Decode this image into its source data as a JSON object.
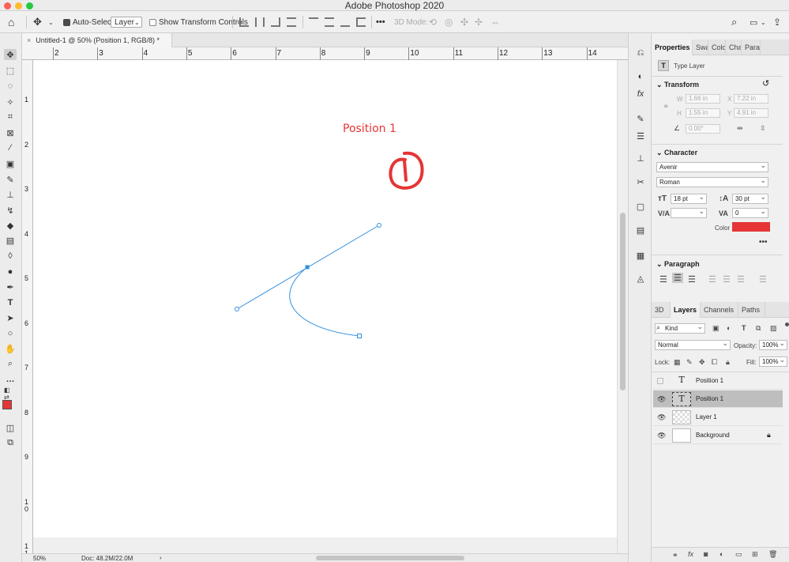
{
  "window": {
    "title": "Adobe Photoshop 2020"
  },
  "options_bar": {
    "auto_select_label": "Auto-Select:",
    "auto_select_value": "Layer",
    "transform_controls_label": "Show Transform Controls",
    "mode_3d_label": "3D Mode:",
    "more_label": "•••"
  },
  "document": {
    "tab_title": "Untitled-1 @ 50% (Position 1, RGB/8) *",
    "close_glyph": "×",
    "zoom": "50%",
    "doc_info": "Doc: 48.2M/22.0M"
  },
  "rulers": {
    "horizontal": [
      "2",
      "3",
      "4",
      "5",
      "6",
      "7",
      "8",
      "9",
      "10",
      "11",
      "12",
      "13",
      "14"
    ],
    "vertical": [
      "1",
      "2",
      "3",
      "4",
      "5",
      "6",
      "7",
      "8",
      "9",
      "1\n0",
      "1\n1"
    ]
  },
  "canvas": {
    "text_layer": "Position 1",
    "text_color": "#e53535",
    "path_color": "#2f8fe0"
  },
  "properties": {
    "tabs": [
      "Properties",
      "Swa",
      "Colo",
      "Cha",
      "Parag"
    ],
    "layer_type": "Type Layer",
    "transform": {
      "heading": "Transform",
      "w": "1.66 in",
      "x": "7.22 in",
      "h": "1.55 in",
      "y": "4.91 in",
      "angle": "0.00°",
      "w_label": "W",
      "h_label": "H",
      "x_label": "X",
      "y_label": "Y"
    },
    "character": {
      "heading": "Character",
      "font_family": "Avenir",
      "font_style": "Roman",
      "size": "18 pt",
      "leading": "30 pt",
      "kerning": "",
      "tracking": "0",
      "color_label": "Color",
      "color": "#e53535",
      "more": "•••"
    },
    "paragraph": {
      "heading": "Paragraph"
    }
  },
  "layers_panel": {
    "tabs": [
      "3D",
      "Layers",
      "Channels",
      "Paths"
    ],
    "kind": "Kind",
    "blend_mode": "Normal",
    "opacity_label": "Opacity:",
    "opacity": "100%",
    "lock_label": "Lock:",
    "fill_label": "Fill:",
    "fill": "100%",
    "layers": [
      {
        "name": "Position 1",
        "type": "text",
        "visible": false,
        "selected": false
      },
      {
        "name": "Position 1",
        "type": "text",
        "visible": true,
        "selected": true
      },
      {
        "name": "Layer 1",
        "type": "pixel",
        "visible": true,
        "selected": false
      },
      {
        "name": "Background",
        "type": "background",
        "visible": true,
        "selected": false
      }
    ]
  },
  "colors": {
    "foreground": "#e53535",
    "background": "#ffffff",
    "accent": "#2f8fe0"
  }
}
